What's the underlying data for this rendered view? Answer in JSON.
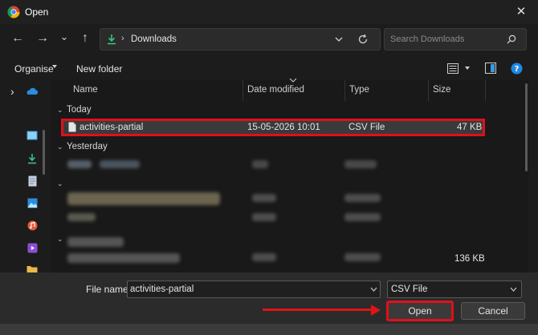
{
  "window": {
    "title": "Open",
    "close_label": "✕"
  },
  "nav": {
    "back": "←",
    "forward": "→",
    "history": "⌄",
    "up": "↑",
    "path_label": "Downloads",
    "search_placeholder": "Search Downloads"
  },
  "toolbar": {
    "organise_label": "Organise",
    "new_folder_label": "New folder"
  },
  "columns": {
    "name": "Name",
    "date": "Date modified",
    "type": "Type",
    "size": "Size"
  },
  "groups": {
    "today": "Today",
    "yesterday": "Yesterday"
  },
  "files": [
    {
      "name": "activities-partial",
      "date": "15-05-2026 10:01",
      "type": "CSV File",
      "size": "47 KB"
    }
  ],
  "extra_size": "136 KB",
  "bottom": {
    "filename_label": "File name:",
    "filename_value": "activities-partial",
    "filetype_value": "CSV File",
    "open_label": "Open",
    "cancel_label": "Cancel"
  },
  "colors": {
    "highlight": "#e0101c",
    "accent": "#0078d4"
  }
}
